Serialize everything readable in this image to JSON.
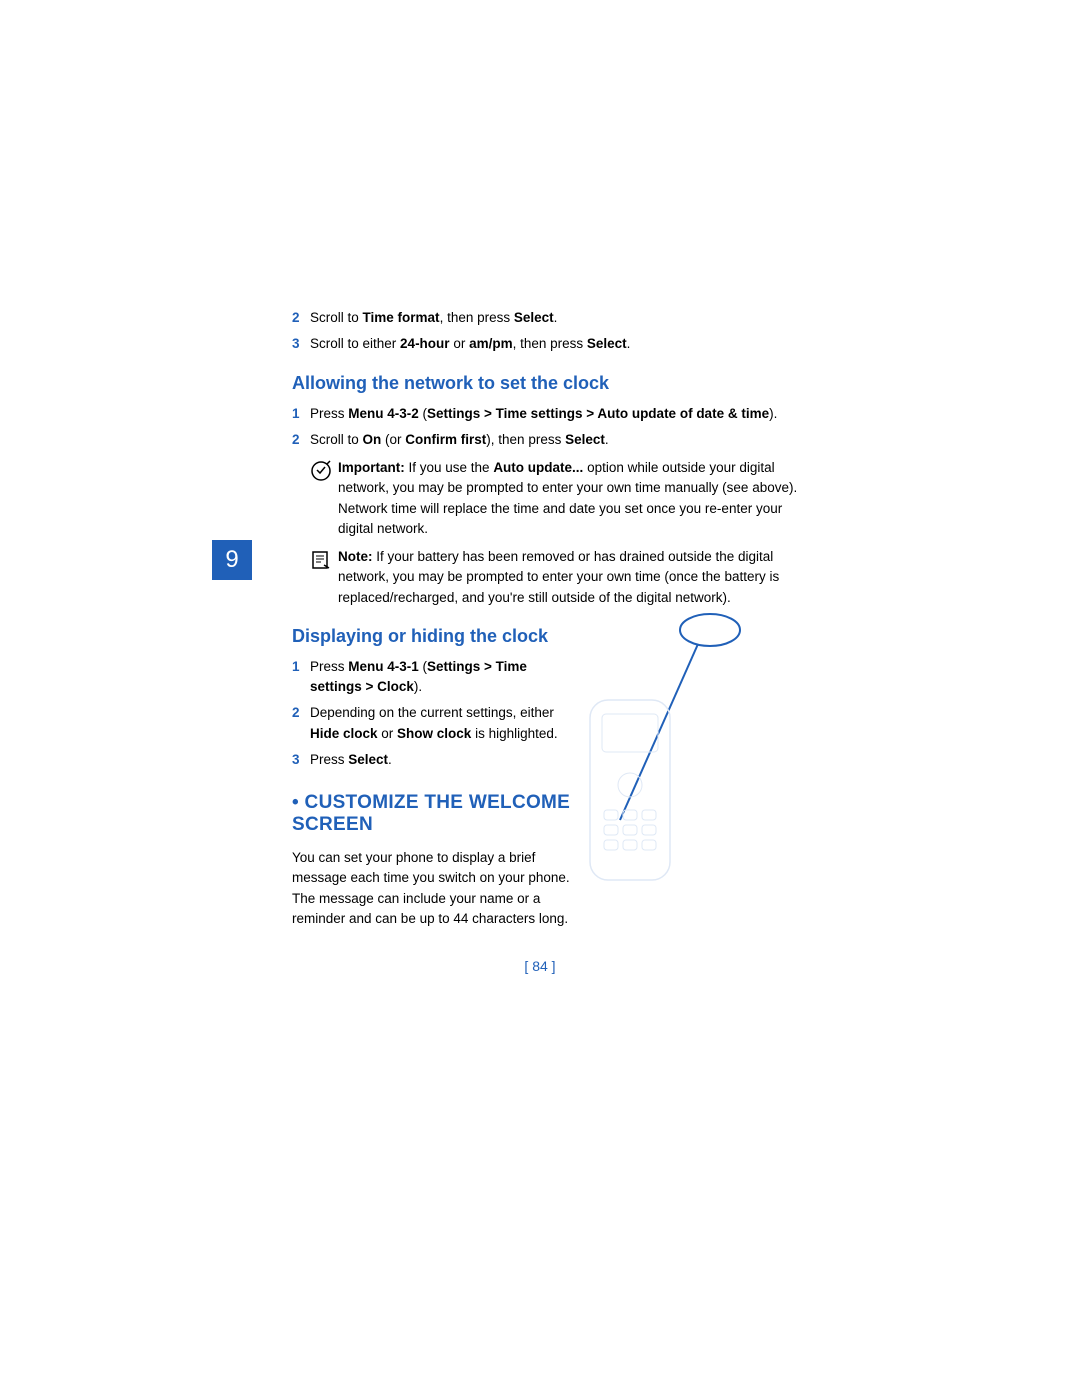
{
  "chapter_number": "9",
  "page_number": "[ 84 ]",
  "intro_steps": [
    {
      "num": "2",
      "parts": [
        "Scroll to ",
        {
          "b": "Time format"
        },
        ", then press ",
        {
          "b": "Select"
        },
        "."
      ]
    },
    {
      "num": "3",
      "parts": [
        "Scroll to either ",
        {
          "b": "24-hour"
        },
        " or ",
        {
          "b": "am/pm"
        },
        ", then press ",
        {
          "b": "Select"
        },
        "."
      ]
    }
  ],
  "section1": {
    "heading": "Allowing the network to set the clock",
    "steps": [
      {
        "num": "1",
        "parts": [
          "Press ",
          {
            "b": "Menu 4-3-2"
          },
          " (",
          {
            "b": "Settings > Time settings > Auto update of date & time"
          },
          ")."
        ]
      },
      {
        "num": "2",
        "parts": [
          "Scroll to ",
          {
            "b": "On"
          },
          " (or ",
          {
            "b": "Confirm first"
          },
          "), then press ",
          {
            "b": "Select"
          },
          "."
        ]
      }
    ],
    "important": {
      "label": "Important:",
      "text_parts": [
        " If you use the ",
        {
          "b": "Auto update..."
        },
        " option while outside your digital network, you may be prompted to enter your own time manually (see above). Network time will replace the time and date you set once you re-enter your digital network."
      ]
    },
    "note": {
      "label": "Note:",
      "text": " If your battery has been removed or has drained outside the digital network, you may be prompted to enter your own time (once the battery is replaced/recharged, and you're still outside of the digital network)."
    }
  },
  "section2": {
    "heading": "Displaying or hiding the clock",
    "steps": [
      {
        "num": "1",
        "parts": [
          "Press ",
          {
            "b": "Menu 4-3-1"
          },
          " (",
          {
            "b": "Settings > Time settings > Clock"
          },
          ")."
        ]
      },
      {
        "num": "2",
        "parts": [
          "Depending on the current settings, either ",
          {
            "b": "Hide clock"
          },
          " or ",
          {
            "b": "Show clock"
          },
          " is highlighted."
        ]
      },
      {
        "num": "3",
        "parts": [
          "Press ",
          {
            "b": "Select"
          },
          "."
        ]
      }
    ]
  },
  "section3": {
    "heading_bullet": "•",
    "heading": "CUSTOMIZE THE WELCOME SCREEN",
    "body": "You can set your phone to display a brief message each time you switch on your phone. The message can include your name or a reminder and can be up to 44 characters long."
  }
}
